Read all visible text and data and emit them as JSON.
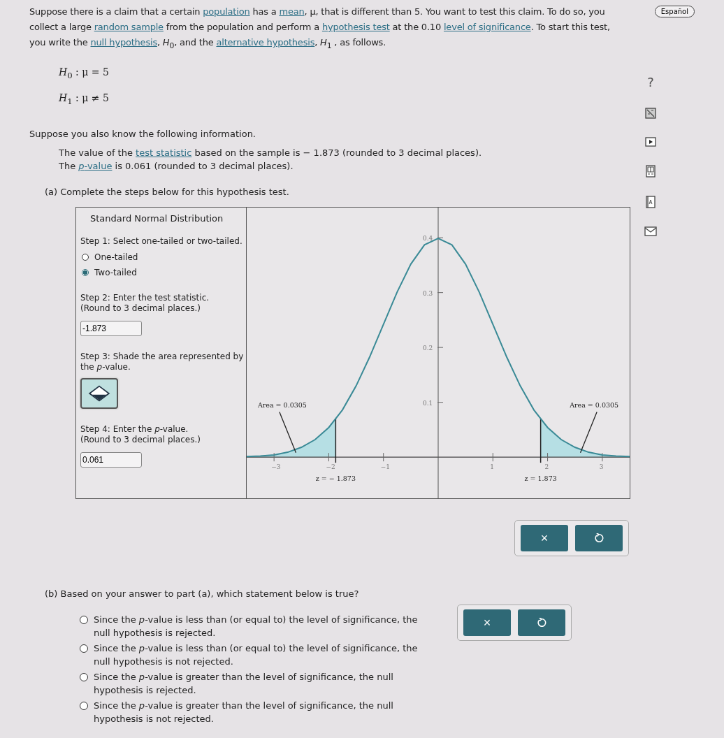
{
  "language_button": "Español",
  "intro": [
    {
      "kind": "text",
      "text": "Suppose there is a claim that a certain "
    },
    {
      "kind": "link",
      "text": "population"
    },
    {
      "kind": "text",
      "text": " has a "
    },
    {
      "kind": "link",
      "text": "mean"
    },
    {
      "kind": "text",
      "text": ", μ, that is different than 5. You want to test this claim. To do so, you collect a large "
    },
    {
      "kind": "link",
      "text": "random sample"
    },
    {
      "kind": "text",
      "text": " from the population and perform a "
    },
    {
      "kind": "link",
      "text": "hypothesis test"
    },
    {
      "kind": "text",
      "text": " at the 0.10 "
    },
    {
      "kind": "link",
      "text": "level of significance"
    },
    {
      "kind": "text",
      "text": ". To start this test, you write the "
    },
    {
      "kind": "link",
      "text": "null hypothesis"
    },
    {
      "kind": "text",
      "text": ", *H*$_{0}$, and the "
    },
    {
      "kind": "link",
      "text": "alternative hypothesis"
    },
    {
      "kind": "text",
      "text": ", *H*$_{1}$ , as follows."
    }
  ],
  "hypotheses": [
    "*H*$_{0}$ : μ = 5",
    "*H*$_{1}$ : μ ≠ 5"
  ],
  "info_heading": "Suppose you also know the following information.",
  "info": [
    [
      {
        "kind": "text",
        "text": "The value of the "
      },
      {
        "kind": "link",
        "text": "test statistic"
      },
      {
        "kind": "text",
        "text": " based on the sample is − 1.873 (rounded to 3 decimal places)."
      }
    ],
    [
      {
        "kind": "text",
        "text": "The "
      },
      {
        "kind": "link",
        "text": "*p*-value"
      },
      {
        "kind": "text",
        "text": " is 0.061 (rounded to 3 decimal places)."
      }
    ]
  ],
  "part_a": {
    "prompt": "(a) Complete the steps below for this hypothesis test.",
    "panel_title": "Standard Normal Distribution",
    "step1": "Step 1: Select one-tailed or two-tailed.",
    "tail_options": [
      {
        "label": "One-tailed",
        "selected": false
      },
      {
        "label": "Two-tailed",
        "selected": true
      }
    ],
    "step2": [
      "Step 2: Enter the test statistic.",
      "(Round to 3 decimal places.)"
    ],
    "test_statistic": "-1.873",
    "step3": "Step 3: Shade the area represented by the *p*-value.",
    "step4": [
      "Step 4: Enter the *p*-value.",
      "(Round to 3 decimal places.)"
    ],
    "p_value": "0.061",
    "chart_data": {
      "type": "line",
      "x": [
        -3.5,
        -3.25,
        -3,
        -2.75,
        -2.5,
        -2.25,
        -2,
        -1.75,
        -1.5,
        -1.25,
        -1,
        -0.75,
        -0.5,
        -0.25,
        0,
        0.25,
        0.5,
        0.75,
        1,
        1.25,
        1.5,
        1.75,
        2,
        2.25,
        2.5,
        2.75,
        3,
        3.25,
        3.5
      ],
      "series": [
        {
          "color": "#3a8a96",
          "values": [
            0.001,
            0.002,
            0.004,
            0.009,
            0.018,
            0.032,
            0.054,
            0.086,
            0.13,
            0.183,
            0.242,
            0.301,
            0.352,
            0.387,
            0.399,
            0.387,
            0.352,
            0.301,
            0.242,
            0.183,
            0.13,
            0.086,
            0.054,
            0.032,
            0.018,
            0.009,
            0.004,
            0.002,
            0.001
          ]
        }
      ],
      "xlim": [
        -3.5,
        3.5
      ],
      "ylim": [
        -0.075,
        0.455
      ],
      "xticks": [
        {
          "value": -3,
          "label": "−3"
        },
        {
          "value": -2,
          "label": "−2"
        },
        {
          "value": -1,
          "label": "−1"
        },
        {
          "value": 1,
          "label": "1"
        },
        {
          "value": 2,
          "label": "2"
        },
        {
          "value": 3,
          "label": "3"
        }
      ],
      "yticks": [
        {
          "value": 0.1,
          "label": "0.1"
        },
        {
          "value": 0.2,
          "label": "0.2"
        },
        {
          "value": 0.3,
          "label": "0.3"
        },
        {
          "value": 0.4,
          "label": "0.4"
        }
      ],
      "ref_lines": [
        {
          "axis": "x",
          "value": -1.873,
          "label": "z = − 1.873"
        },
        {
          "axis": "x",
          "value": 1.873,
          "label": "z = 1.873"
        }
      ],
      "annotations": [
        "Area = 0.0305",
        "Area = 0.0305"
      ]
    },
    "buttons": [
      "×"
    ]
  },
  "part_b": {
    "prompt": "(b) Based on your answer to part (a), which statement below is true?",
    "options": [
      {
        "label": "Since the *p*-value is less than (or equal to) the level of significance, the null hypothesis is rejected.",
        "selected": false
      },
      {
        "label": "Since the *p*-value is less than (or equal to) the level of significance, the null hypothesis is not rejected.",
        "selected": false
      },
      {
        "label": "Since the *p*-value is greater than the level of significance, the null hypothesis is rejected.",
        "selected": false
      },
      {
        "label": "Since the *p*-value is greater than the level of significance, the null hypothesis is not rejected.",
        "selected": false
      }
    ],
    "buttons": [
      "×"
    ]
  },
  "side_tools": [
    "?"
  ]
}
